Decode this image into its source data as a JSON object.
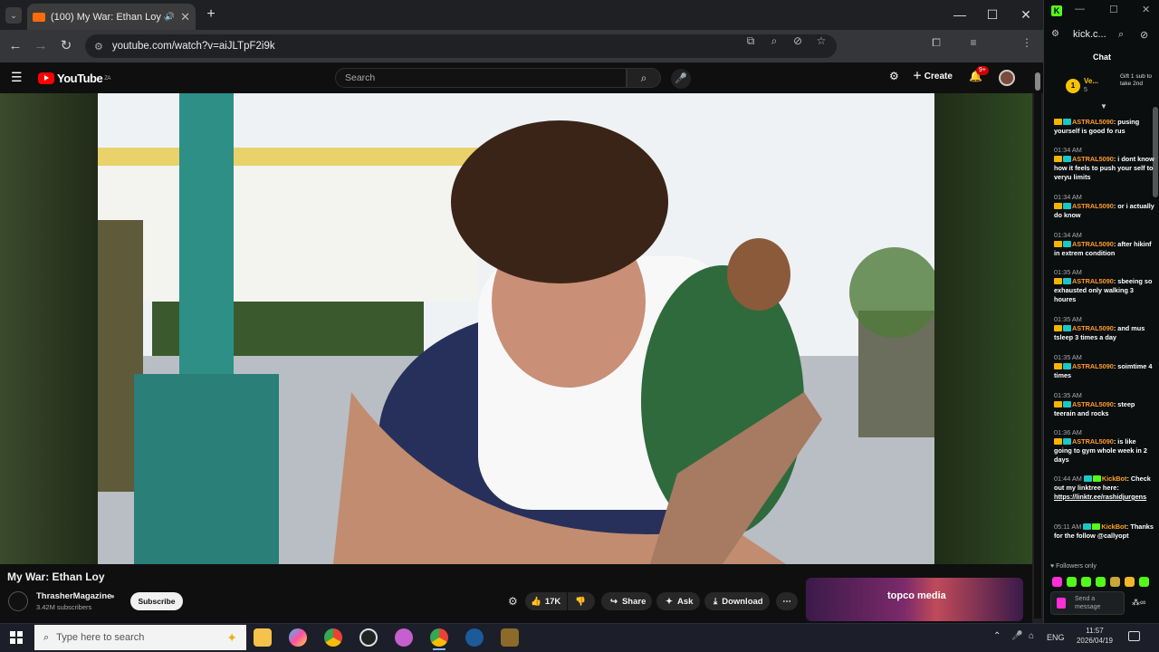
{
  "browser": {
    "tab_title": "(100) My War: Ethan Loy - YouTube",
    "new_tab": "+",
    "url": "youtube.com/watch?v=aiJLTpF2i9k",
    "window_controls": {
      "minimize": "—",
      "maximize": "☐",
      "close": "✕"
    }
  },
  "youtube": {
    "logo": "YouTube",
    "logo_region": "ZA",
    "search_placeholder": "Search",
    "create_label": "Create",
    "notif_count": "9+",
    "video_title": "My War: Ethan Loy",
    "channel_name": "ThrasherMagazine",
    "subscribers": "3.42M subscribers",
    "subscribe_label": "Subscribe",
    "like_count": "17K",
    "share_label": "Share",
    "ask_label": "Ask",
    "download_label": "Download",
    "ad_text": "topco media"
  },
  "kick": {
    "tab_title": "kick.c...",
    "chat_heading": "Chat",
    "pinned_user": "Ve...",
    "pinned_sub": "5",
    "gift_text": "Gift 1 sub to take 2nd",
    "messages": [
      {
        "time": "",
        "user": "ASTRAL5090",
        "text": ": pusing yourself is good fo rus"
      },
      {
        "time": "01:34 AM",
        "user": "ASTRAL5090",
        "text": ": i dont know how it feels to push your self to veryu limits"
      },
      {
        "time": "01:34 AM",
        "user": "ASTRAL5090",
        "text": ": or i actually do know"
      },
      {
        "time": "01:34 AM",
        "user": "ASTRAL5090",
        "text": ": after hikinf in extrem condition"
      },
      {
        "time": "01:35 AM",
        "user": "ASTRAL5090",
        "text": ": sbeeing so exhausted only walking 3 houres"
      },
      {
        "time": "01:35 AM",
        "user": "ASTRAL5090",
        "text": ": and mus tsleep 3 times a day"
      },
      {
        "time": "01:35 AM",
        "user": "ASTRAL5090",
        "text": ": soimtime 4 times"
      },
      {
        "time": "01:35 AM",
        "user": "ASTRAL5090",
        "text": ": steep teerain and rocks"
      },
      {
        "time": "01:36 AM",
        "user": "ASTRAL5090",
        "text": ": is like going to gym whole week in 2 days"
      },
      {
        "time": "01:44 AM",
        "user": "KickBot",
        "text": ": Check out my linktree here:",
        "link": "https://linktr.ee/rashidjurgens"
      },
      {
        "time": "05:11 AM",
        "user": "KickBot",
        "text": ": Thanks for the follow @callyopt"
      }
    ],
    "followers_only": "Followers only",
    "send_placeholder": "Send a message"
  },
  "taskbar": {
    "search_placeholder": "Type here to search",
    "lang": "ENG",
    "time": "11:57",
    "date": "2026/04/19"
  }
}
